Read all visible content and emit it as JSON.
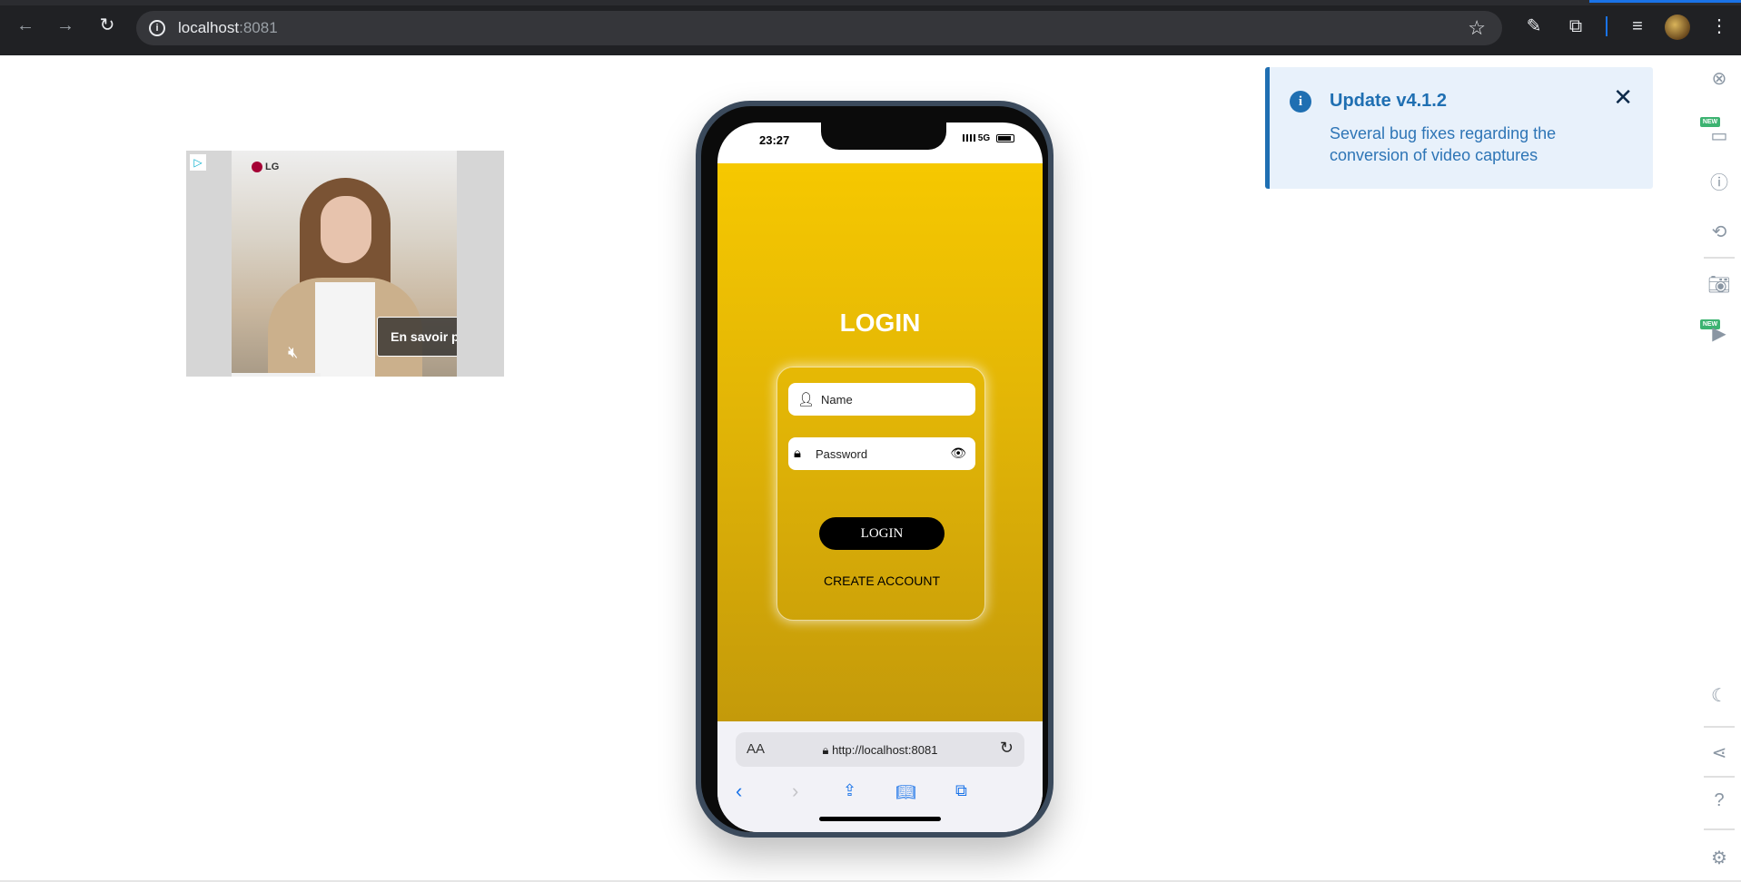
{
  "browser": {
    "url_host": "localhost",
    "url_port": ":8081"
  },
  "ad": {
    "brand": "LG",
    "cta": "En savoir plus"
  },
  "phone": {
    "status_time": "23:27",
    "network": "5G",
    "login_title": "LOGIN",
    "name_placeholder": "Name",
    "password_placeholder": "Password",
    "login_button": "LOGIN",
    "create_account": "CREATE ACCOUNT",
    "safari_aa": "AA",
    "safari_url": "http://localhost:8081"
  },
  "toast": {
    "title": "Update v4.1.2",
    "body": "Several bug fixes regarding the conversion of video captures"
  },
  "sidebar": {
    "new_badge": "NEW"
  },
  "colors": {
    "app_yellow": "#f6c800",
    "toast_blue": "#1f6fb2",
    "new_badge": "#3cb371"
  }
}
